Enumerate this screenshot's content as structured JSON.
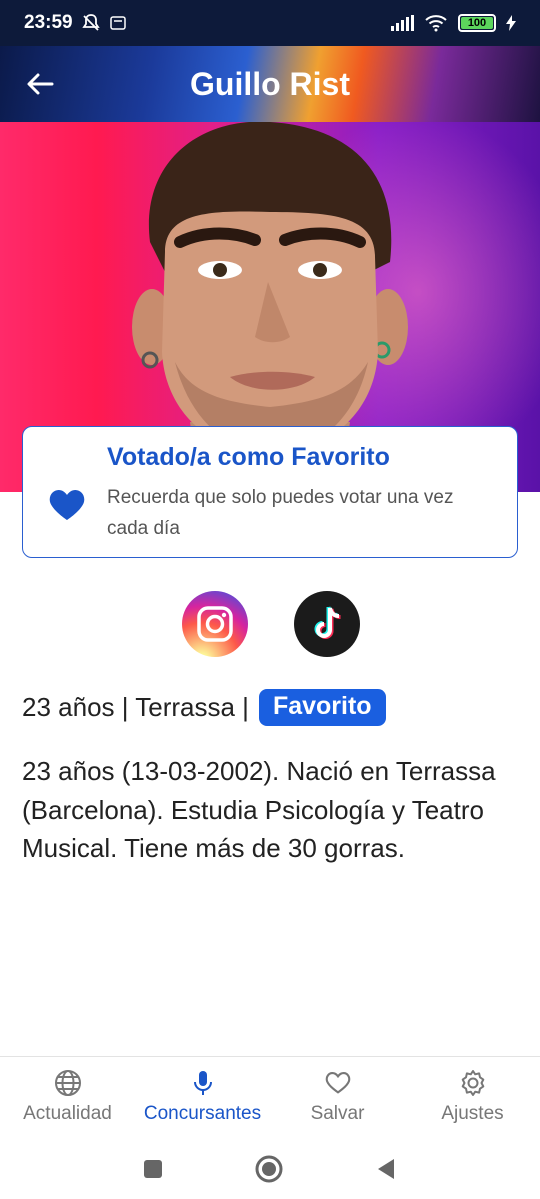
{
  "status": {
    "time": "23:59",
    "battery": "100"
  },
  "header": {
    "title": "Guillo Rist"
  },
  "vote_card": {
    "title": "Votado/a como Favorito",
    "subtitle": "Recuerda que solo puedes votar una vez cada día"
  },
  "social": {
    "icons": [
      "instagram-icon",
      "tiktok-icon"
    ]
  },
  "info": {
    "text": "23 años | Terrassa |",
    "badge": "Favorito"
  },
  "bio": "23 años (13-03-2002). Nació en Terrassa (Barcelona). Estudia Psicología y Teatro Musical. Tiene más de 30 gorras.",
  "nav": {
    "items": [
      {
        "label": "Actualidad",
        "icon": "globe-icon"
      },
      {
        "label": "Concursantes",
        "icon": "microphone-icon",
        "active": true
      },
      {
        "label": "Salvar",
        "icon": "heart-icon"
      },
      {
        "label": "Ajustes",
        "icon": "gear-icon"
      }
    ]
  },
  "colors": {
    "accent": "#1a55c8",
    "badge": "#1a5fe0"
  }
}
